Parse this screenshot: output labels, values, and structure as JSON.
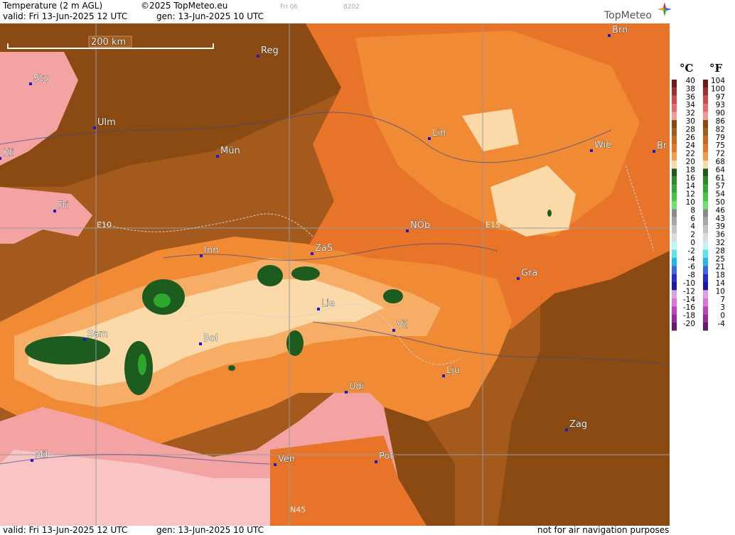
{
  "header": {
    "title": "Temperature (2 m AGL)",
    "copyright": "©2025 TopMeteo.eu",
    "day_tag": "Fri 06",
    "code": "8202",
    "valid": "valid:  Fri  13-Jun-2025  12 UTC",
    "gen": "gen: 13-Jun-2025 10 UTC"
  },
  "logo": {
    "text": "TopMeteo",
    "icon": "compass-star-icon"
  },
  "map": {
    "scale_label": "200 km",
    "grid_labels": {
      "e10": "E10",
      "e15": "E15",
      "n45": "N45"
    },
    "cities": [
      "Stu",
      "Reg",
      "Brn",
      "Ulm",
      "Kli",
      "Mün",
      "Lin",
      "Wie",
      "Br",
      "Fri",
      "NÖb",
      "E15",
      "Inn",
      "ZaS",
      "Gra",
      "Lie",
      "Vil",
      "Sam",
      "Bol",
      "Lju",
      "Udi",
      "Zag",
      "Mil",
      "Ven",
      "Pot"
    ],
    "colors": {
      "brown_dark": "#8a4a12",
      "brown": "#a45a1c",
      "orange_dark": "#d9651c",
      "orange": "#f08a35",
      "orange_light": "#f7ad66",
      "cream": "#fbd9a8",
      "pink": "#f4a3a3",
      "pink_light": "#f8c4c4",
      "green_dark": "#1e5b1e",
      "green": "#2da82d"
    }
  },
  "legend": {
    "unit_c": "°C",
    "unit_f": "°F",
    "celsius": [
      "40",
      "38",
      "36",
      "34",
      "32",
      "30",
      "28",
      "26",
      "24",
      "22",
      "20",
      "18",
      "16",
      "14",
      "12",
      "10",
      "8",
      "6",
      "4",
      "2",
      "0",
      "-2",
      "-4",
      "-6",
      "-8",
      "-10",
      "-12",
      "-14",
      "-16",
      "-18",
      "-20"
    ],
    "fahrenheit": [
      "104",
      "100",
      "97",
      "93",
      "90",
      "86",
      "82",
      "79",
      "75",
      "72",
      "68",
      "64",
      "61",
      "57",
      "54",
      "50",
      "46",
      "43",
      "39",
      "36",
      "32",
      "28",
      "25",
      "21",
      "18",
      "14",
      "10",
      "7",
      "3",
      "0",
      "-4"
    ],
    "colors": [
      "#6a1b1b",
      "#a03030",
      "#d04a4a",
      "#e86a6a",
      "#f29a9a",
      "#8a4a12",
      "#a45a1c",
      "#c86a1c",
      "#e8742a",
      "#f59c4c",
      "#fbd9a8",
      "#1e5b1e",
      "#2d8a2d",
      "#34a834",
      "#44c844",
      "#6fe06f",
      "#8a8a8a",
      "#a6a6a6",
      "#c2c2c2",
      "#dcdcdc",
      "#bdf6f6",
      "#5ee6e6",
      "#1fb8e8",
      "#3a6ae8",
      "#2a2ad0",
      "#1a1aa0",
      "#e0a0e0",
      "#e070e0",
      "#c040c0",
      "#9a2a9a",
      "#6a1a6a"
    ]
  },
  "footer": {
    "valid": "valid:  Fri  13-Jun-2025  12 UTC",
    "gen": "gen: 13-Jun-2025 10 UTC",
    "note": "not for air navigation purposes"
  }
}
